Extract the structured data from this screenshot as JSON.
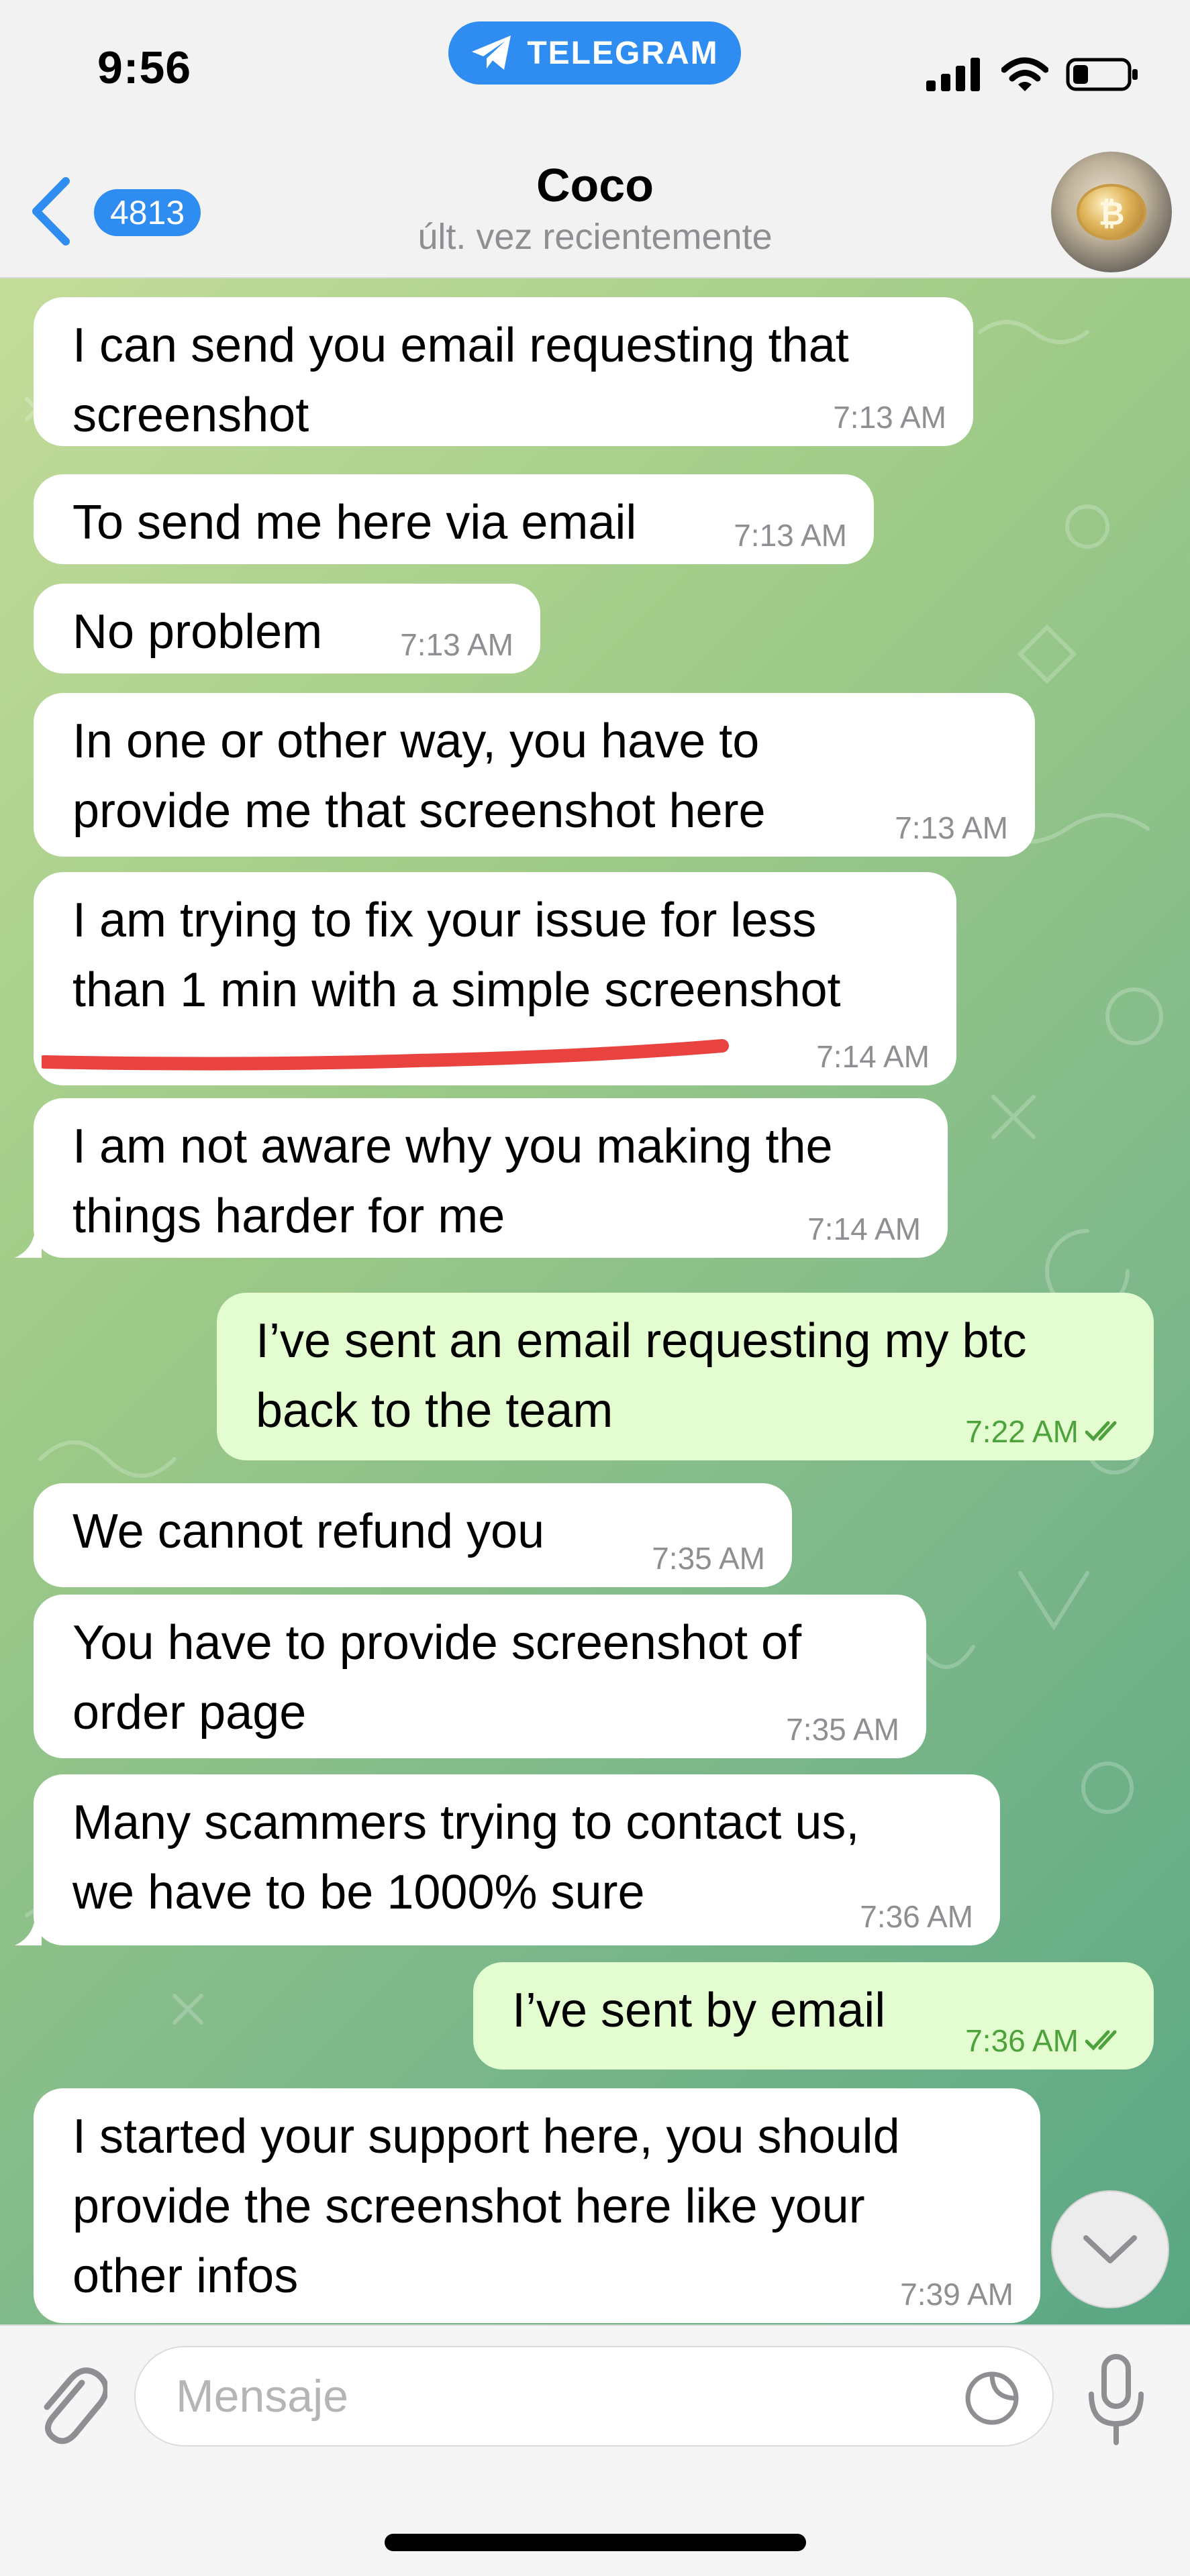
{
  "status_bar": {
    "time": "9:56",
    "app_badge": "TELEGRAM"
  },
  "header": {
    "back_count": "4813",
    "title": "Coco",
    "subtitle": "últ. vez recientemente",
    "avatar_icon": "bitcoin-coin"
  },
  "messages": [
    {
      "direction": "in",
      "text": "I can send you email requesting that\nscreenshot",
      "time": "7:13 AM"
    },
    {
      "direction": "in",
      "text": "To send me here via email",
      "time": "7:13 AM"
    },
    {
      "direction": "in",
      "text": "No problem",
      "time": "7:13 AM"
    },
    {
      "direction": "in",
      "text": "In one or other way, you have to\nprovide me that screenshot here",
      "time": "7:13 AM"
    },
    {
      "direction": "in",
      "text": "I am trying to fix your issue for less\nthan 1 min with a simple screenshot",
      "time": "7:14 AM"
    },
    {
      "direction": "in",
      "text": "I am not aware why you making the\nthings harder for me",
      "time": "7:14 AM"
    },
    {
      "direction": "out",
      "text": "I’ve sent an email requesting my btc\nback to the team",
      "time": "7:22 AM",
      "read": true
    },
    {
      "direction": "in",
      "text": "We cannot refund you",
      "time": "7:35 AM"
    },
    {
      "direction": "in",
      "text": "You have to provide screenshot of\norder page",
      "time": "7:35 AM"
    },
    {
      "direction": "in",
      "text": "Many scammers trying to contact us,\nwe have to be 1000% sure",
      "time": "7:36 AM"
    },
    {
      "direction": "out",
      "text": "I’ve sent by email",
      "time": "7:36 AM",
      "read": true
    },
    {
      "direction": "in",
      "text": "I started your support here, you should\nprovide the screenshot here like your\nother infos",
      "time": "7:39 AM"
    }
  ],
  "composer": {
    "placeholder": "Mensaje",
    "value": ""
  },
  "colors": {
    "accent": "#2f8cf0",
    "incoming_bubble": "#ffffff",
    "outgoing_bubble": "#e3fdd0",
    "outgoing_meta": "#4ea23c",
    "annotation_underline": "#e8433f"
  }
}
